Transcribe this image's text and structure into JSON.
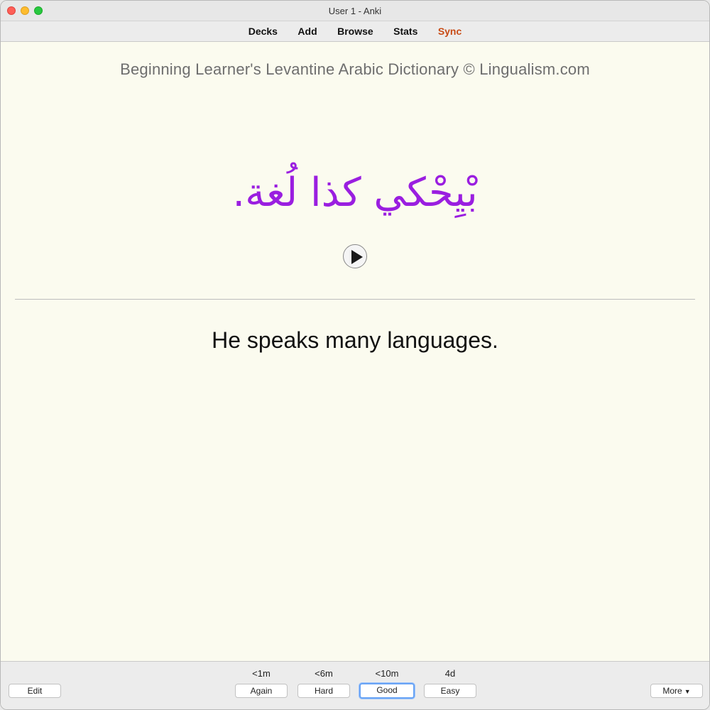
{
  "window": {
    "title": "User 1 - Anki"
  },
  "toolbar": {
    "decks": "Decks",
    "add": "Add",
    "browse": "Browse",
    "stats": "Stats",
    "sync": "Sync"
  },
  "card": {
    "deck_header": "Beginning Learner's Levantine Arabic Dictionary © Lingualism.com",
    "arabic_text": "بْيِحْكي كذا لُغة.",
    "english_text": "He speaks many languages."
  },
  "bottom": {
    "edit_label": "Edit",
    "more_label": "More",
    "answers": [
      {
        "interval": "<1m",
        "label": "Again"
      },
      {
        "interval": "<6m",
        "label": "Hard"
      },
      {
        "interval": "<10m",
        "label": "Good"
      },
      {
        "interval": "4d",
        "label": "Easy"
      }
    ]
  },
  "colors": {
    "arabic": "#9a1ee0",
    "sync": "#c84b16",
    "card_bg": "#fbfbef",
    "focus_ring": "#6aa4f5"
  },
  "icons": {
    "play": "play-icon",
    "caret": "caret-down-icon"
  }
}
